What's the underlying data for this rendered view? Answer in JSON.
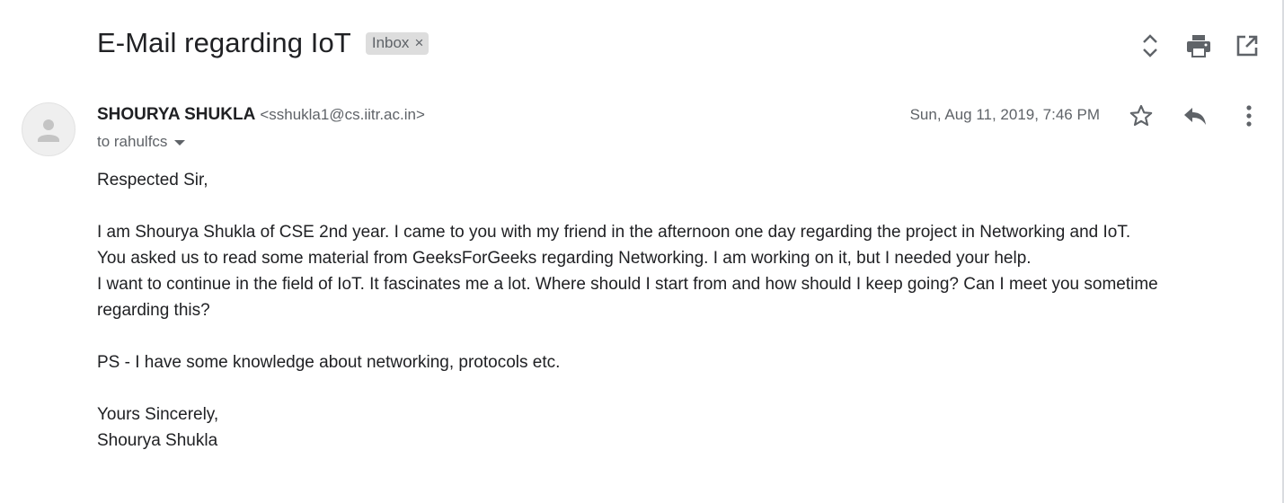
{
  "subject": "E-Mail regarding IoT",
  "label": {
    "name": "Inbox",
    "remove_symbol": "×"
  },
  "toolbar": {
    "icons": [
      "expand-collapse-icon",
      "print-icon",
      "open-new-window-icon"
    ]
  },
  "sender": {
    "name": "SHOURYA SHUKLA",
    "email": "<sshukla1@cs.iitr.ac.in>",
    "to": "to rahulfcs",
    "date": "Sun, Aug 11, 2019, 7:46 PM"
  },
  "message_actions": {
    "icons": [
      "star-icon",
      "reply-icon",
      "more-vert-icon"
    ]
  },
  "body": {
    "greeting": "Respected Sir,",
    "line1": "I am Shourya Shukla of CSE 2nd year. I came to you with my friend in the afternoon one day regarding the project in Networking and IoT.",
    "line2": "You asked us to read some material from GeeksForGeeks regarding Networking. I am working on it, but I needed your help.",
    "line3": "I want to continue in the field of IoT. It fascinates me a lot. Where should I start from and how should I keep going? Can I meet you sometime regarding this?",
    "ps": "PS - I have some knowledge about networking, protocols etc.",
    "closing": "Yours Sincerely,",
    "signature": "Shourya Shukla"
  },
  "colors": {
    "text_primary": "#202124",
    "text_secondary": "#5f6368",
    "chip_bg": "#dddddd",
    "avatar_bg": "#efefef"
  }
}
